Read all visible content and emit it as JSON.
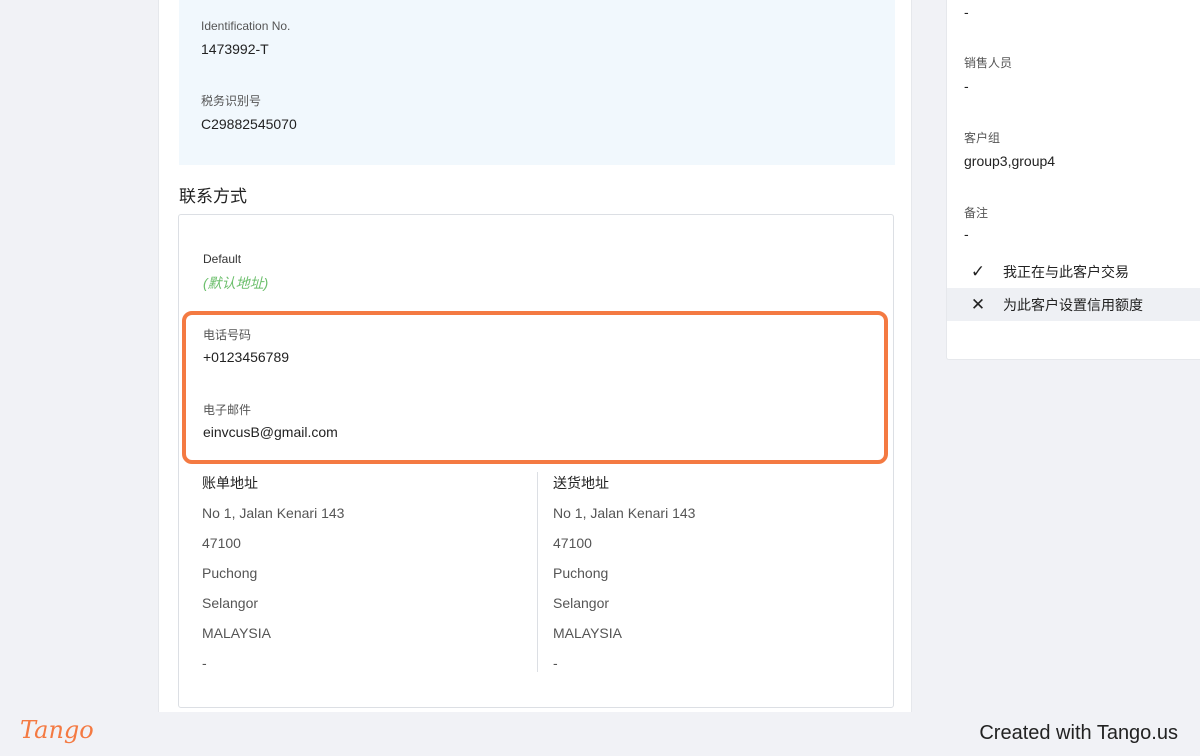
{
  "identification": {
    "id_label": "Identification No.",
    "id_value": "1473992-T",
    "tax_label": "税务识别号",
    "tax_value": "C29882545070"
  },
  "contact": {
    "section_title": "联系方式",
    "default_label": "Default",
    "default_value": "(默认地址)",
    "phone_label": "电话号码",
    "phone_value": "+0123456789",
    "email_label": "电子邮件",
    "email_value": "einvcusB@gmail.com"
  },
  "billing": {
    "title": "账单地址",
    "lines": [
      "No 1, Jalan Kenari 143",
      "47100",
      "Puchong",
      "Selangor",
      "MALAYSIA",
      "-"
    ]
  },
  "shipping": {
    "title": "送货地址",
    "lines": [
      "No 1, Jalan Kenari 143",
      "47100",
      "Puchong",
      "Selangor",
      "MALAYSIA",
      "-"
    ]
  },
  "sidebar": {
    "top_value": "-",
    "sales_label": "销售人员",
    "sales_value": "-",
    "group_label": "客户组",
    "group_value": "group3,group4",
    "notes_label": "备注",
    "notes_value": "-",
    "options": [
      {
        "icon": "check-icon",
        "label": "我正在与此客户交易"
      },
      {
        "icon": "close-icon",
        "label": "为此客户设置信用额度"
      }
    ]
  },
  "footer": {
    "logo": "Tango",
    "created": "Created with Tango.us"
  },
  "colors": {
    "highlight": "#f47a42",
    "default_green": "#6cbf6c",
    "id_panel_bg": "#f1f8fd"
  }
}
